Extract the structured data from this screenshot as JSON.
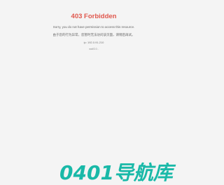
{
  "error": {
    "title": "403 Forbidden",
    "message_en": "Sorry, you do not have permission to access this resource.",
    "message_cn": "由于您的行为异常，您暂时无法访问该页面，请稍后再试。",
    "ip_line": "ip: 192.0.91.210",
    "version": "waf/2.0 -"
  },
  "watermark": {
    "text": "0401导航库"
  },
  "colors": {
    "title": "#e0584e",
    "watermark": "#19b9a8",
    "background": "#f4f4f4"
  }
}
